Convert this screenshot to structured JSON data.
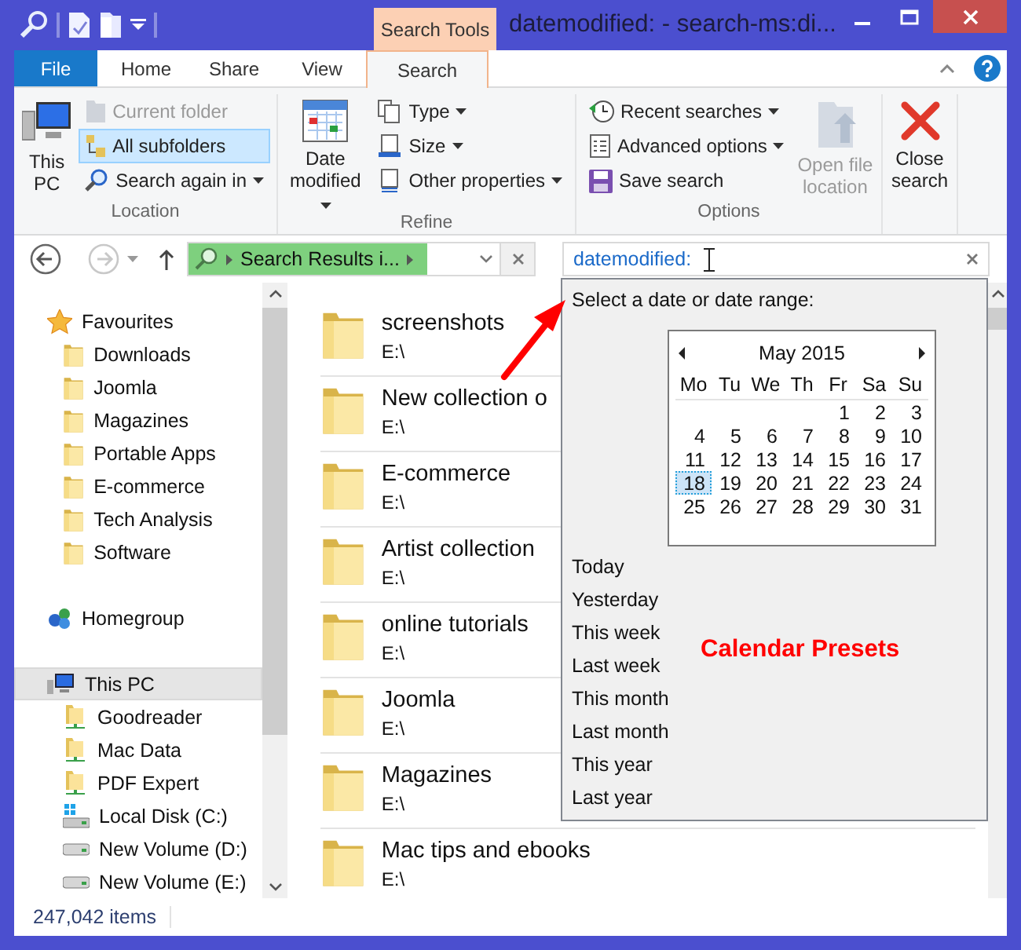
{
  "title_bar": {
    "context_tab": "Search Tools",
    "title": "datemodified: - search-ms:di..."
  },
  "ribbon_tabs": [
    {
      "label": "File",
      "kind": "file",
      "selected": false
    },
    {
      "label": "Home",
      "kind": "tab",
      "selected": false
    },
    {
      "label": "Share",
      "kind": "tab",
      "selected": false
    },
    {
      "label": "View",
      "kind": "tab",
      "selected": false
    },
    {
      "label": "Search",
      "kind": "tab",
      "selected": true
    }
  ],
  "ribbon": {
    "location": {
      "label": "Location",
      "this_pc": "This PC",
      "current_folder": {
        "label": "Current folder",
        "disabled": true
      },
      "all_subfolders": {
        "label": "All subfolders",
        "selected": true
      },
      "search_again_in": "Search again in"
    },
    "refine": {
      "label": "Refine",
      "date_modified": "Date modified",
      "type": "Type",
      "size": "Size",
      "other_properties": "Other properties"
    },
    "options": {
      "label": "Options",
      "recent_searches": "Recent searches",
      "advanced_options": "Advanced options",
      "save_search": "Save search",
      "open_file_location": {
        "label": "Open file location",
        "disabled": true
      }
    },
    "close_search": "Close search"
  },
  "address_bar": {
    "back": {
      "disabled": false
    },
    "forward": {
      "disabled": true
    },
    "location": "Search Results i...",
    "search_value": "datemodified:"
  },
  "navigation": [
    {
      "label": "Favourites",
      "kind": "favourites",
      "selected": false,
      "children": [
        {
          "label": "Downloads",
          "kind": "folder",
          "selected": false
        },
        {
          "label": "Joomla",
          "kind": "folder",
          "selected": false
        },
        {
          "label": "Magazines",
          "kind": "folder",
          "selected": false
        },
        {
          "label": "Portable Apps",
          "kind": "folder",
          "selected": false
        },
        {
          "label": "E-commerce",
          "kind": "folder",
          "selected": false
        },
        {
          "label": "Tech Analysis",
          "kind": "folder",
          "selected": false
        },
        {
          "label": "Software",
          "kind": "folder",
          "selected": false
        }
      ]
    },
    {
      "label": "Homegroup",
      "kind": "homegroup",
      "selected": false
    },
    {
      "label": "This PC",
      "kind": "pc",
      "selected": true,
      "children": [
        {
          "label": "Goodreader",
          "kind": "network-folder",
          "selected": false
        },
        {
          "label": "Mac Data",
          "kind": "network-folder",
          "selected": false
        },
        {
          "label": "PDF Expert",
          "kind": "network-folder",
          "selected": false
        },
        {
          "label": "Local Disk (C:)",
          "kind": "system-drive",
          "selected": false
        },
        {
          "label": "New Volume (D:)",
          "kind": "drive",
          "selected": false
        },
        {
          "label": "New Volume (E:)",
          "kind": "drive",
          "selected": false
        }
      ]
    }
  ],
  "files": [
    {
      "name": "screenshots",
      "path": "E:\\"
    },
    {
      "name": "New collection o",
      "path": "E:\\"
    },
    {
      "name": "E-commerce",
      "path": "E:\\"
    },
    {
      "name": "Artist collection",
      "path": "E:\\"
    },
    {
      "name": "online tutorials",
      "path": "E:\\"
    },
    {
      "name": "Joomla",
      "path": "E:\\"
    },
    {
      "name": "Magazines",
      "path": "E:\\"
    },
    {
      "name": "Mac tips and ebooks",
      "path": "E:\\"
    }
  ],
  "status_bar": {
    "item_count": "247,042 items"
  },
  "date_popup": {
    "prompt": "Select a date or date range:",
    "calendar": {
      "month": "May 2015",
      "weekdays": [
        "Mo",
        "Tu",
        "We",
        "Th",
        "Fr",
        "Sa",
        "Su"
      ],
      "weeks": [
        [
          {
            "label": "1",
            "selected": false
          },
          {
            "label": "2",
            "selected": false
          },
          {
            "label": "3",
            "selected": false
          }
        ],
        [
          {
            "label": "4",
            "selected": false
          },
          {
            "label": "5",
            "selected": false
          },
          {
            "label": "6",
            "selected": false
          },
          {
            "label": "7",
            "selected": false
          },
          {
            "label": "8",
            "selected": false
          },
          {
            "label": "9",
            "selected": false
          },
          {
            "label": "10",
            "selected": false
          }
        ],
        [
          {
            "label": "11",
            "selected": false
          },
          {
            "label": "12",
            "selected": false
          },
          {
            "label": "13",
            "selected": false
          },
          {
            "label": "14",
            "selected": false
          },
          {
            "label": "15",
            "selected": false
          },
          {
            "label": "16",
            "selected": false
          },
          {
            "label": "17",
            "selected": false
          }
        ],
        [
          {
            "label": "18",
            "selected": true
          },
          {
            "label": "19",
            "selected": false
          },
          {
            "label": "20",
            "selected": false
          },
          {
            "label": "21",
            "selected": false
          },
          {
            "label": "22",
            "selected": false
          },
          {
            "label": "23",
            "selected": false
          },
          {
            "label": "24",
            "selected": false
          }
        ],
        [
          {
            "label": "25",
            "selected": false
          },
          {
            "label": "26",
            "selected": false
          },
          {
            "label": "27",
            "selected": false
          },
          {
            "label": "28",
            "selected": false
          },
          {
            "label": "29",
            "selected": false
          },
          {
            "label": "30",
            "selected": false
          },
          {
            "label": "31",
            "selected": false
          }
        ]
      ]
    },
    "presets": [
      "Today",
      "Yesterday",
      "This week",
      "Last week",
      "This month",
      "Last month",
      "This year",
      "Last year"
    ]
  },
  "annotation": {
    "text": "Calendar Presets"
  }
}
